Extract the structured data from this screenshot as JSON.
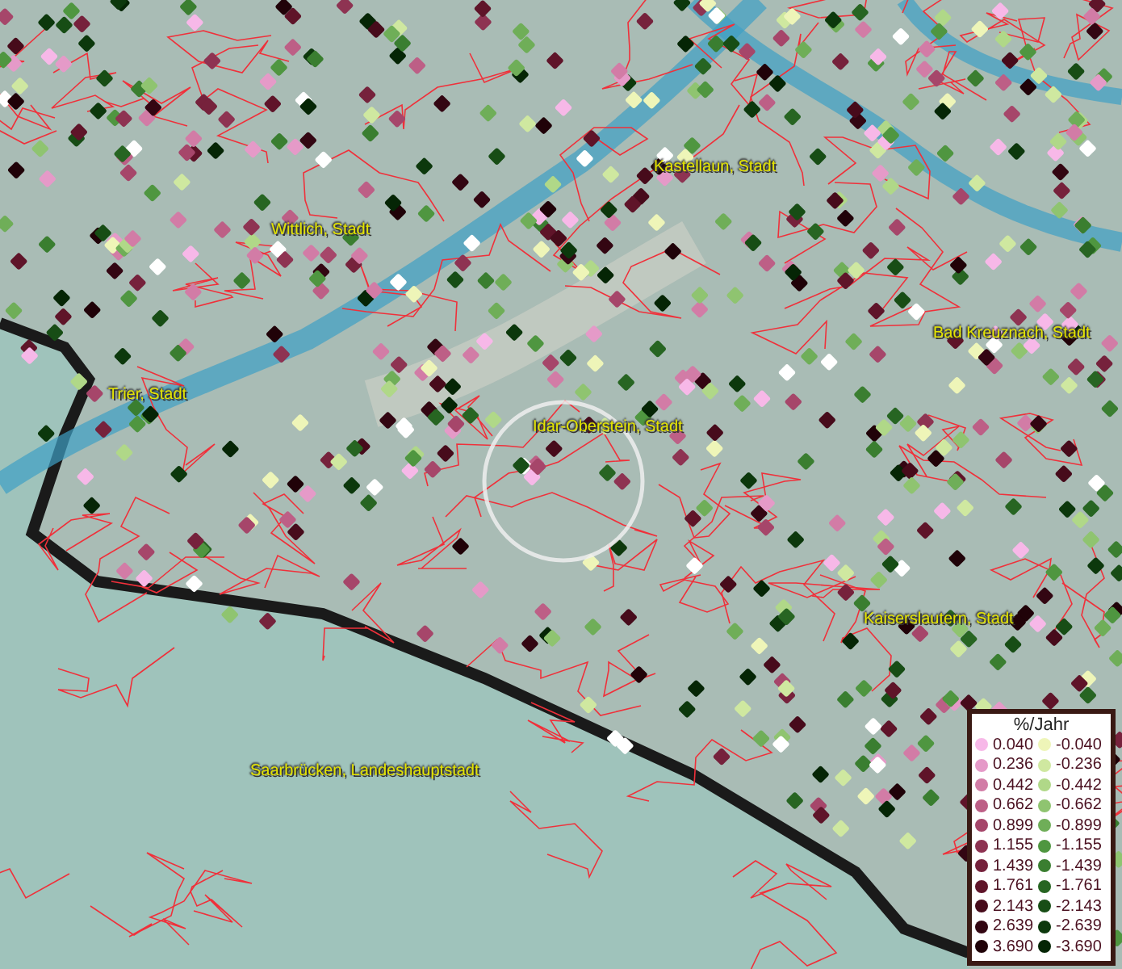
{
  "map": {
    "places": [
      {
        "name": "Kastellaun, Stadt"
      },
      {
        "name": "Wittlich, Stadt"
      },
      {
        "name": "Bad Kreuznach, Stadt"
      },
      {
        "name": "Trier, Stadt"
      },
      {
        "name": "Idar-Oberstein, Stadt"
      },
      {
        "name": "Kaiserslautern, Stadt"
      },
      {
        "name": "Saarbrücken, Landeshauptstadt"
      }
    ]
  },
  "legend": {
    "title": "%/Jahr",
    "positive": [
      {
        "label": "0.040",
        "color": "#f7b8e8"
      },
      {
        "label": "0.236",
        "color": "#e59ac8"
      },
      {
        "label": "0.442",
        "color": "#d27ca6"
      },
      {
        "label": "0.662",
        "color": "#bd5f86"
      },
      {
        "label": "0.899",
        "color": "#a6466a"
      },
      {
        "label": "1.155",
        "color": "#8e3352"
      },
      {
        "label": "1.439",
        "color": "#76223c"
      },
      {
        "label": "1.761",
        "color": "#5f1429"
      },
      {
        "label": "2.143",
        "color": "#470b1b"
      },
      {
        "label": "2.639",
        "color": "#330612"
      },
      {
        "label": "3.690",
        "color": "#200208"
      }
    ],
    "negative": [
      {
        "label": "-0.040",
        "color": "#eef5b8"
      },
      {
        "label": "-0.236",
        "color": "#cfe8a0"
      },
      {
        "label": "-0.442",
        "color": "#b0d888"
      },
      {
        "label": "-0.662",
        "color": "#8fc470"
      },
      {
        "label": "-0.899",
        "color": "#6fae58"
      },
      {
        "label": "-1.155",
        "color": "#4f9640"
      },
      {
        "label": "-1.439",
        "color": "#3a7e30"
      },
      {
        "label": "-1.761",
        "color": "#276522"
      },
      {
        "label": "-2.143",
        "color": "#174d15"
      },
      {
        "label": "-2.639",
        "color": "#0c380c"
      },
      {
        "label": "-3.690",
        "color": "#052505"
      }
    ]
  }
}
